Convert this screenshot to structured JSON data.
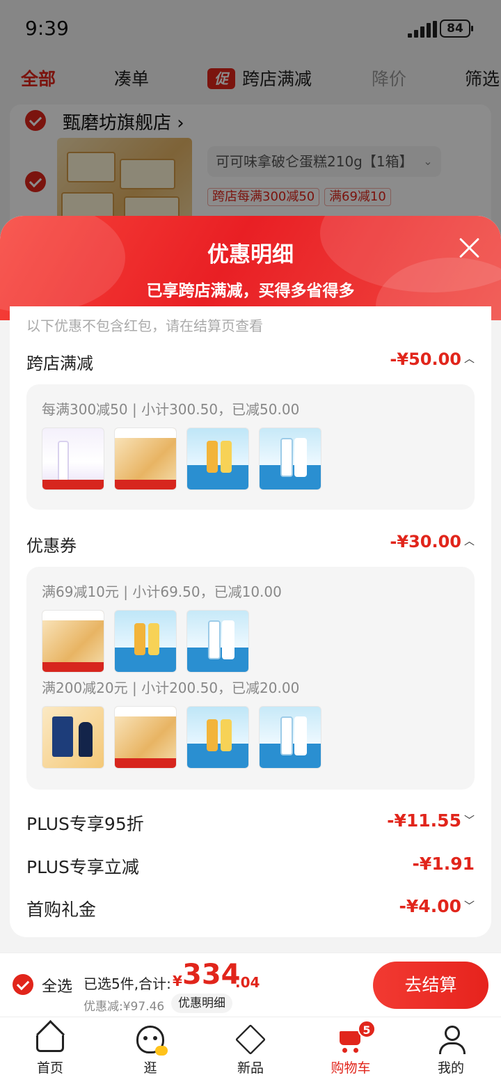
{
  "status": {
    "time": "9:39",
    "battery": "84"
  },
  "filter_tabs": [
    {
      "label": "全部",
      "state": "active"
    },
    {
      "label": "凑单",
      "state": "normal"
    },
    {
      "label": "跨店满减",
      "badge": "促",
      "state": "normal"
    },
    {
      "label": "降价",
      "state": "muted"
    },
    {
      "label": "筛选",
      "state": "normal"
    }
  ],
  "store": {
    "name": "甄磨坊旗舰店",
    "name_chevron": "›",
    "sku": "可可味拿破仑蛋糕210g【1箱】",
    "sku_chevron": "⌄",
    "tags": [
      "跨店每满300减50",
      "满69减10"
    ]
  },
  "sheet": {
    "title": "优惠明细",
    "subtitle": "已享跨店满减，买得多省得多",
    "note": "以下优惠不包含红包，请在结算页查看",
    "sections": {
      "cross_store": {
        "label": "跨店满减",
        "amount": "-¥50.00",
        "line": "每满300减50 | 小计300.50，已减50.00",
        "thumbs": [
          "skincare",
          "cake",
          "juice",
          "milk"
        ]
      },
      "coupon": {
        "label": "优惠券",
        "amount": "-¥30.00",
        "line1": "满69减10元 | 小计69.50，已减10.00",
        "thumbs1": [
          "cake",
          "juice",
          "milk"
        ],
        "line2": "满200减20元 | 小计200.50，已减20.00",
        "thumbs2": [
          "liquor",
          "cake",
          "juice",
          "milk"
        ]
      },
      "plus_discount": {
        "label": "PLUS专享95折",
        "amount": "-¥11.55"
      },
      "plus_cut": {
        "label": "PLUS专享立减",
        "amount": "-¥1.91"
      },
      "first_gift": {
        "label": "首购礼金",
        "amount": "-¥4.00"
      }
    }
  },
  "checkout": {
    "select_all": "全选",
    "selected_info": "已选5件,合计:",
    "currency": "¥",
    "total_int": "334",
    "total_dec": ".04",
    "discount": "优惠减:¥97.46",
    "detail_button": "优惠明细",
    "submit": "去结算"
  },
  "tabbar": [
    {
      "label": "首页",
      "icon": "home-icon"
    },
    {
      "label": "逛",
      "icon": "browse-icon"
    },
    {
      "label": "新品",
      "icon": "new-products-icon"
    },
    {
      "label": "购物车",
      "icon": "cart-icon",
      "badge": "5",
      "active": true
    },
    {
      "label": "我的",
      "icon": "profile-icon"
    }
  ],
  "colors": {
    "accent": "#e1251b",
    "header_gradient_start": "#f7433a",
    "header_gradient_end": "#e91f24"
  }
}
